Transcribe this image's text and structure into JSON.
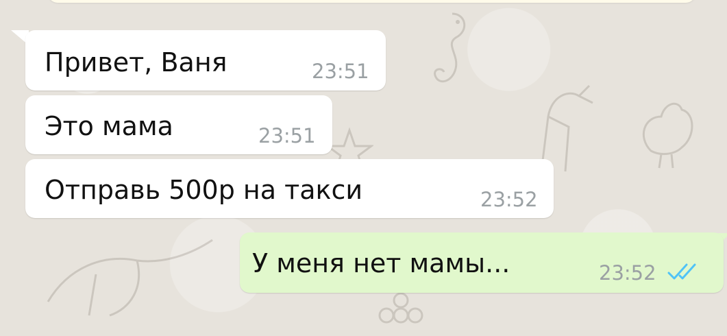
{
  "chat": {
    "messages": [
      {
        "direction": "incoming",
        "text": "Привет, Ваня",
        "time": "23:51"
      },
      {
        "direction": "incoming",
        "text": "Это мама",
        "time": "23:51"
      },
      {
        "direction": "incoming",
        "text": "Отправь 500р на такси",
        "time": "23:52"
      },
      {
        "direction": "outgoing",
        "text": "У меня нет мамы...",
        "time": "23:52",
        "status_icon": "double-check-read-icon"
      }
    ],
    "colors": {
      "incoming_bubble": "#ffffff",
      "outgoing_bubble": "#e1f8cc",
      "read_ticks": "#4fc3f7",
      "timestamp": "#9aa0a3"
    }
  }
}
